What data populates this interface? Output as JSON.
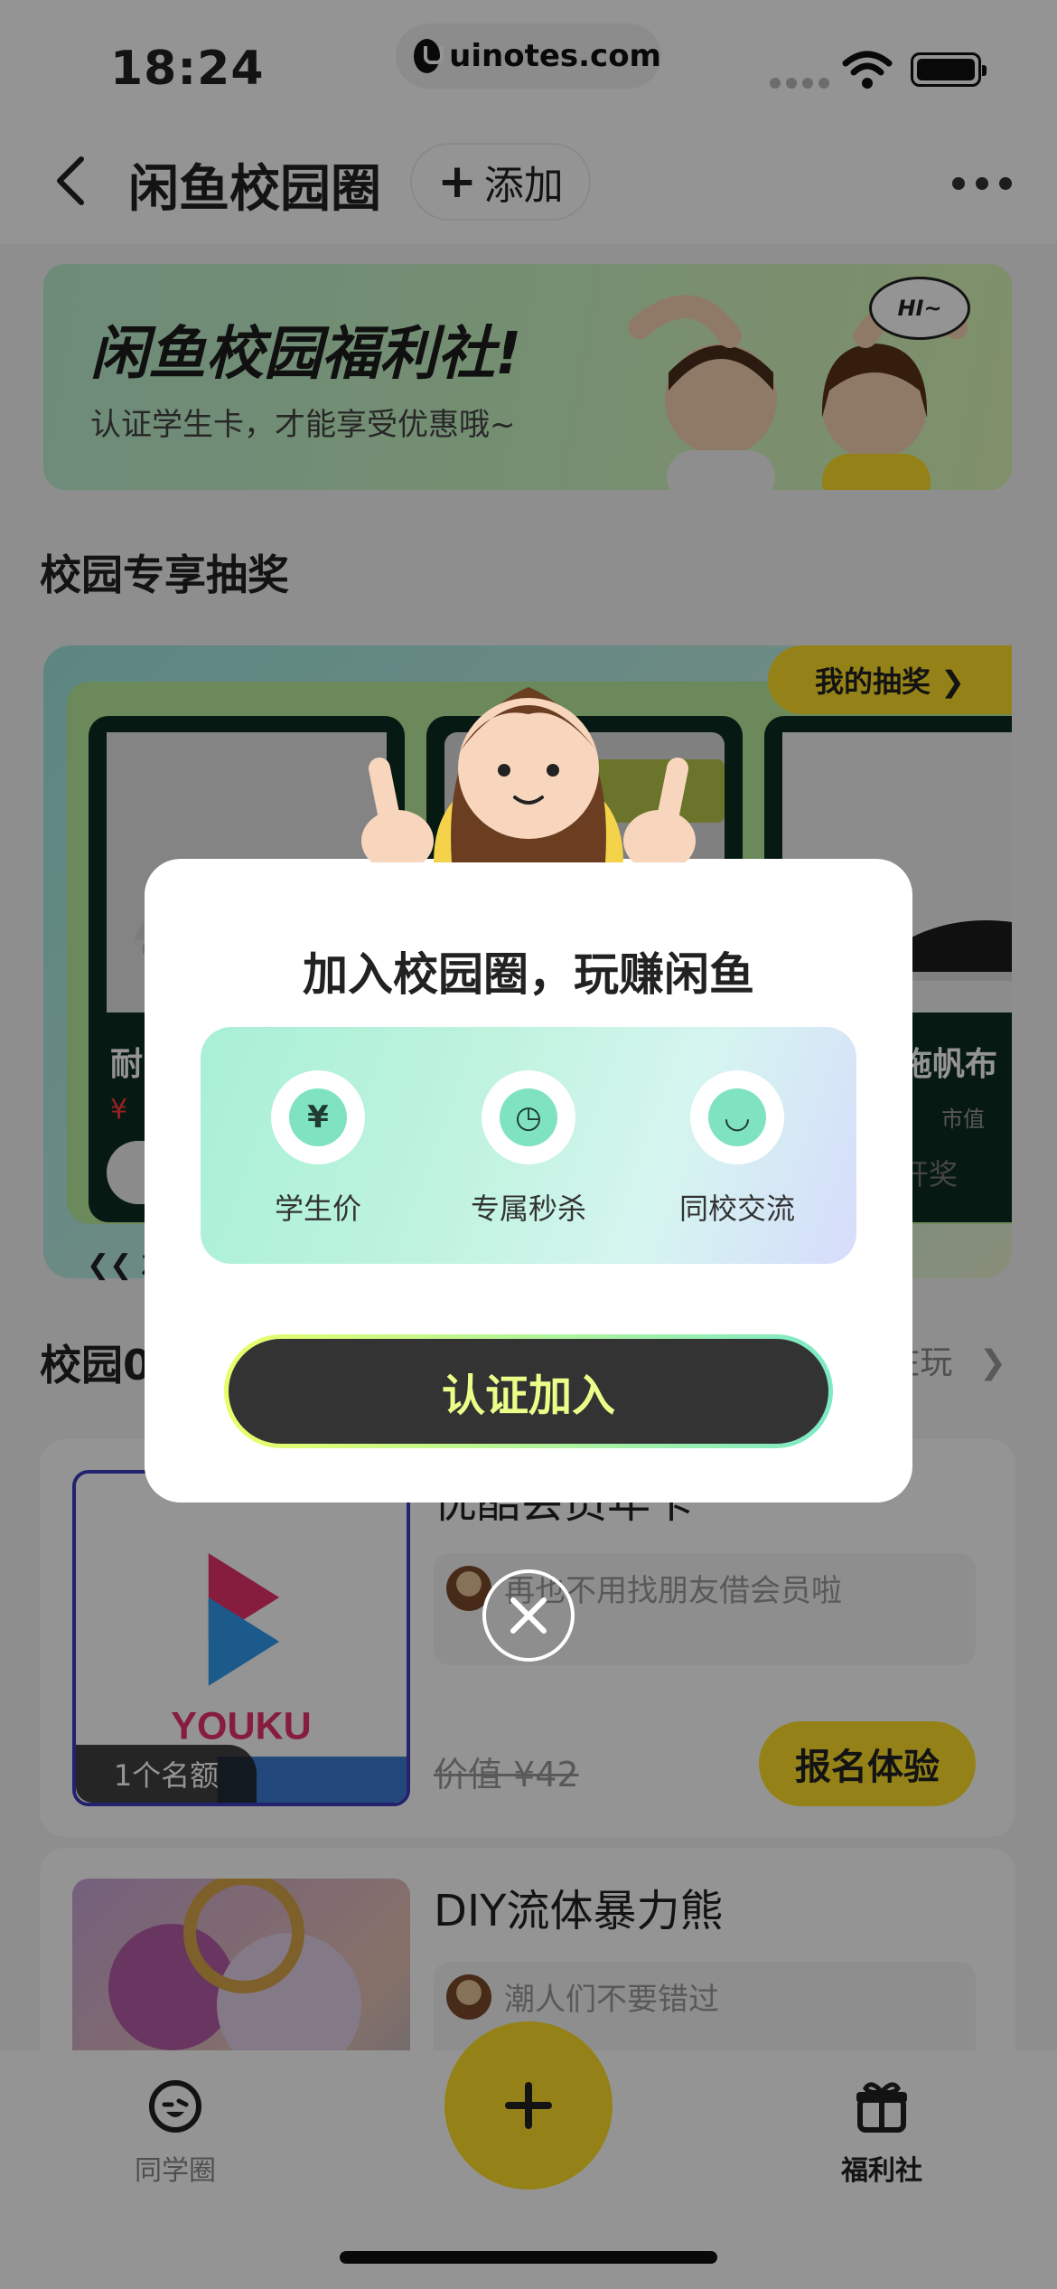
{
  "status_bar": {
    "time": "18:24",
    "url": "uinotes.com"
  },
  "nav": {
    "title": "闲鱼校园圈",
    "add_label": "添加"
  },
  "banner": {
    "title": "闲鱼校园福利社!",
    "subtitle": "认证学生卡，才能享受优惠哦~",
    "bubble": "HI~"
  },
  "lottery_section": {
    "title": "校园专享抽奖",
    "my_lottery": "我的抽奖 ❯",
    "footer_visible": "❮❮ 左",
    "prizes": [
      {
        "name": "耐",
        "price_prefix": "¥"
      },
      {
        "name": ""
      },
      {
        "name": "拖帆布",
        "worth": "市值",
        "button": "开奖"
      }
    ]
  },
  "ticket_section": {
    "title_partial": "校园0",
    "right_partial": "在玩"
  },
  "experiences": [
    {
      "title": "优酷会员年卡",
      "tag": "再也不用找朋友借会员啦",
      "worth": "价值 ¥42",
      "button": "报名体验",
      "slots": "1个名额",
      "brand": "YOUKU"
    },
    {
      "title": "DIY流体暴力熊",
      "tag": "潮人们不要错过"
    }
  ],
  "tabbar": {
    "left_label": "同学圈",
    "right_label": "福利社"
  },
  "modal": {
    "title": "加入校园圈，玩赚闲鱼",
    "benefits": [
      {
        "icon": "yen-icon",
        "glyph": "¥",
        "label": "学生价"
      },
      {
        "icon": "clock-icon",
        "glyph": "◷",
        "label": "专属秒杀"
      },
      {
        "icon": "smile-icon",
        "glyph": "◡",
        "label": "同校交流"
      }
    ],
    "cta": "认证加入"
  },
  "colors": {
    "accent_yellow": "#ffe12b",
    "cta_bg": "#333333",
    "cta_text": "#e9ff8a"
  }
}
